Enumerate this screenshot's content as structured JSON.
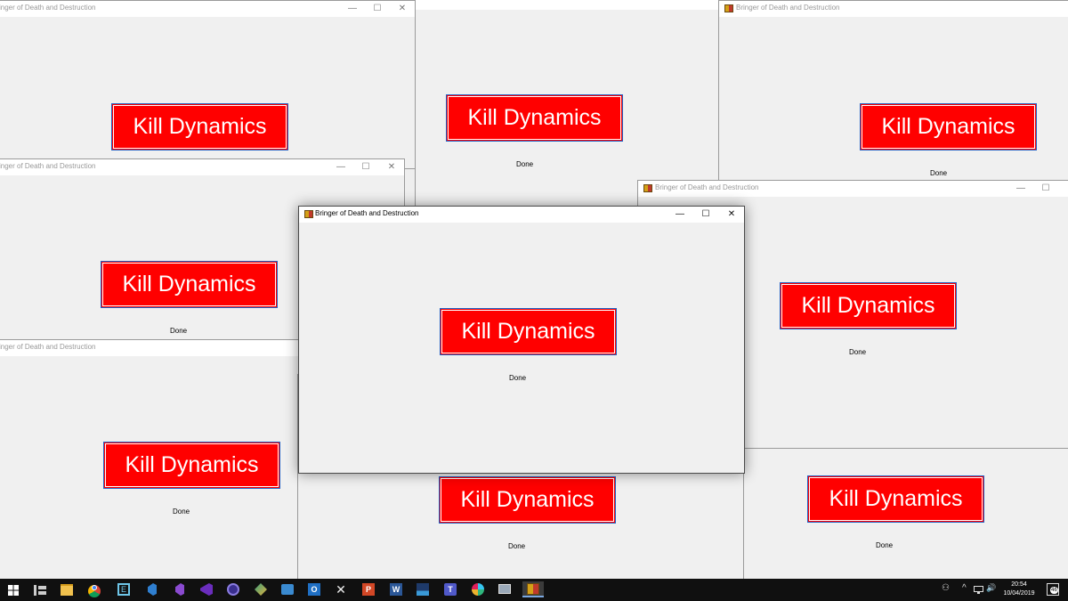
{
  "windows": [
    {
      "title": "Bringer of Death and Destruction",
      "button_label": "Kill Dynamics",
      "status": "Done"
    },
    {
      "title": "Bringer of Death and Destruction",
      "button_label": "Kill Dynamics",
      "status": "Done"
    },
    {
      "title": "Bringer of Death and Destruction",
      "button_label": "Kill Dynamics",
      "status": "Done"
    },
    {
      "title": "Bringer of Death and Destruction",
      "button_label": "Kill Dynamics",
      "status": "Done"
    },
    {
      "title": "Bringer of Death and Destruction",
      "button_label": "Kill Dynamics",
      "status": "Done"
    },
    {
      "title": "Bringer of Death and Destruction",
      "button_label": "Kill Dynamics",
      "status": "Done"
    },
    {
      "title": "Bringer of Death and Destruction",
      "button_label": "Kill Dynamics",
      "status": "Done"
    },
    {
      "title": "Bringer of Death and Destruction",
      "button_label": "Kill Dynamics",
      "status": "Done"
    }
  ],
  "window_controls": {
    "minimize": "—",
    "maximize": "☐",
    "close": "✕"
  },
  "taskbar": {
    "start_icon": "windows-logo-icon",
    "pinned_icons": [
      "task-view-icon",
      "file-explorer-icon",
      "chrome-icon",
      "terminal-icon",
      "vscode-icon",
      "visual-studio-icon",
      "visual-studio-icon",
      "notes-icon",
      "app-icon",
      "outlook-icon",
      "tools-icon",
      "powerpoint-icon",
      "word-icon",
      "chart-app-icon",
      "teams-icon",
      "slack-icon",
      "remote-desktop-icon",
      "bringer-app-icon"
    ],
    "tray": {
      "people_glyph": "⚇",
      "chevron_glyph": "^",
      "speaker_glyph": "🔊",
      "notifications_badge": "46"
    },
    "clock": {
      "time": "20:54",
      "date": "10/04/2019"
    }
  },
  "colors": {
    "kill_button": "#ff0000",
    "kill_border": "#1f5fc4",
    "window_bg": "#f0f0f0",
    "taskbar_bg": "#101010"
  }
}
